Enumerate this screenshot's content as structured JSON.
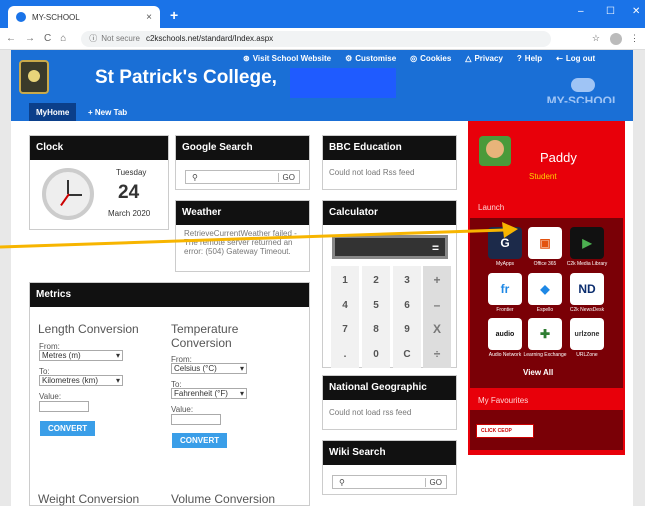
{
  "browser": {
    "tab_title": "MY-SCHOOL",
    "tab_close": "×",
    "new_tab": "+",
    "controls": [
      "–",
      "☐",
      "✕"
    ],
    "nav": [
      "←",
      "→",
      "C",
      "⌂"
    ],
    "not_secure": "Not secure",
    "url": "c2kschools.net/standard/Index.aspx",
    "star": "☆",
    "menu": "⋮"
  },
  "header": {
    "college_name": "St Patrick's College,",
    "links": [
      {
        "icon": "⊛",
        "label": "Visit School Website"
      },
      {
        "icon": "⚙",
        "label": "Customise"
      },
      {
        "icon": "◎",
        "label": "Cookies"
      },
      {
        "icon": "△",
        "label": "Privacy"
      },
      {
        "icon": "?",
        "label": "Help"
      },
      {
        "icon": "⇠",
        "label": "Log out"
      }
    ],
    "myschool_logo": "MY-SCHOOL"
  },
  "tabs": {
    "home": "MyHome",
    "new_tab": "+ New Tab"
  },
  "clock": {
    "title": "Clock",
    "weekday": "Tuesday",
    "day": "24",
    "month_year": "March 2020"
  },
  "google": {
    "title": "Google Search",
    "icon": "⚲",
    "go": "GO"
  },
  "weather": {
    "title": "Weather",
    "message": "RetrieveCurrentWeather failed - The remote server returned an error: (504) Gateway Timeout."
  },
  "bbc": {
    "title": "BBC Education",
    "message": "Could not load Rss feed"
  },
  "calculator": {
    "title": "Calculator",
    "equals": "=",
    "keys": [
      [
        "1",
        "2",
        "3",
        "+"
      ],
      [
        "4",
        "5",
        "6",
        "–"
      ],
      [
        "7",
        "8",
        "9",
        "X"
      ],
      [
        ".",
        "0",
        "C",
        "÷"
      ]
    ]
  },
  "natgeo": {
    "title": "National Geographic",
    "message": "Could not load rss feed"
  },
  "wiki": {
    "title": "Wiki Search",
    "icon": "⚲",
    "go": "GO"
  },
  "metrics": {
    "title": "Metrics",
    "length": {
      "heading": "Length Conversion",
      "from_label": "From:",
      "from_value": "Metres (m)",
      "to_label": "To:",
      "to_value": "Kilometres (km)",
      "value_label": "Value:",
      "button": "CONVERT"
    },
    "temperature": {
      "heading": "Temperature Conversion",
      "from_label": "From:",
      "from_value": "Celsius (°C)",
      "to_label": "To:",
      "to_value": "Fahrenheit (°F)",
      "value_label": "Value:",
      "button": "CONVERT"
    },
    "weight_heading": "Weight Conversion",
    "volume_heading": "Volume Conversion"
  },
  "profile": {
    "name": "Paddy",
    "role": "Student"
  },
  "launch": {
    "title": "Launch",
    "apps": [
      {
        "label": "MyApps",
        "glyph": "G",
        "bg": "#1c2a4a",
        "fg": "#ffffff"
      },
      {
        "label": "Office 365",
        "glyph": "▣",
        "bg": "#ffffff",
        "fg": "#e3520f"
      },
      {
        "label": "C2k Media Library",
        "glyph": "▶",
        "bg": "#111111",
        "fg": "#4caf50"
      },
      {
        "label": "Frontier",
        "glyph": "fr",
        "bg": "#ffffff",
        "fg": "#1e88e5"
      },
      {
        "label": "Espello",
        "glyph": "◆",
        "bg": "#ffffff",
        "fg": "#1e88e5"
      },
      {
        "label": "C2k NewsDesk",
        "glyph": "ND",
        "bg": "#ffffff",
        "fg": "#0b2d6e"
      },
      {
        "label": "Audio Network",
        "glyph": "audio",
        "bg": "#ffffff",
        "fg": "#111111"
      },
      {
        "label": "Learning Exchange",
        "glyph": "✚",
        "bg": "#ffffff",
        "fg": "#2e7d32"
      },
      {
        "label": "URLZone",
        "glyph": "urlzone",
        "bg": "#ffffff",
        "fg": "#333333"
      }
    ],
    "view_all": "View All"
  },
  "favourites": {
    "title": "My Favourites",
    "ceop": "CLICK CEOP"
  },
  "colors": {
    "brand_blue": "#1a6fd6",
    "sidebar_red": "#e8000a",
    "arrow": "#f7b500"
  }
}
